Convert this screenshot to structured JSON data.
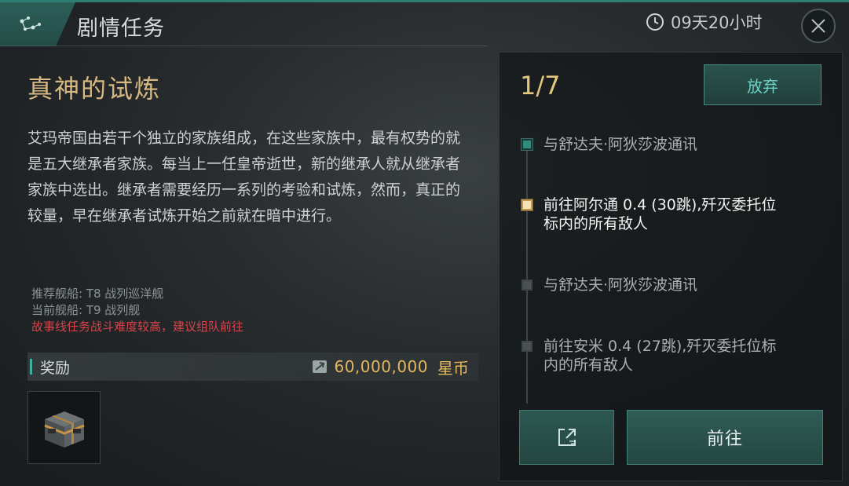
{
  "header": {
    "title": "剧情任务",
    "timer": "09天20小时",
    "icon": "network-nodes-icon",
    "timer_icon": "clock-icon",
    "close_icon": "close-icon"
  },
  "mission": {
    "title": "真神的试炼",
    "description": "艾玛帝国由若干个独立的家族组成，在这些家族中，最有权势的就是五大继承者家族。每当上一任皇帝逝世，新的继承人就从继承者家族中选出。继承者需要经历一系列的考验和试炼，然而，真正的较量，早在继承者试炼开始之前就在暗中进行。",
    "recommended_ship": "推荐舰船: T8 战列巡洋舰",
    "current_ship": "当前舰船: T9 战列舰",
    "warning": "故事线任务战斗难度较高，建议组队前往"
  },
  "reward": {
    "label": "奖励",
    "amount": "60,000,000",
    "unit": "星币",
    "currency_icon": "star-coin-icon",
    "item_icon": "supply-crate-icon"
  },
  "progress": {
    "text": "1/7",
    "abandon_label": "放弃"
  },
  "steps": [
    {
      "text": "与舒达夫·阿狄莎波通讯",
      "state": "done"
    },
    {
      "text": "前往阿尔通 0.4 (30跳),歼灭委托位标内的所有敌人",
      "state": "active"
    },
    {
      "text": "与舒达夫·阿狄莎波通讯",
      "state": "pending"
    },
    {
      "text": "前往安米 0.4 (27跳),歼灭委托位标内的所有敌人",
      "state": "pending"
    }
  ],
  "actions": {
    "link_icon": "external-link-icon",
    "go_label": "前往"
  },
  "colors": {
    "accent": "#2f7e73",
    "gold": "#e4b85d",
    "title_gold": "#d8b982",
    "warning_red": "#d8434a"
  }
}
